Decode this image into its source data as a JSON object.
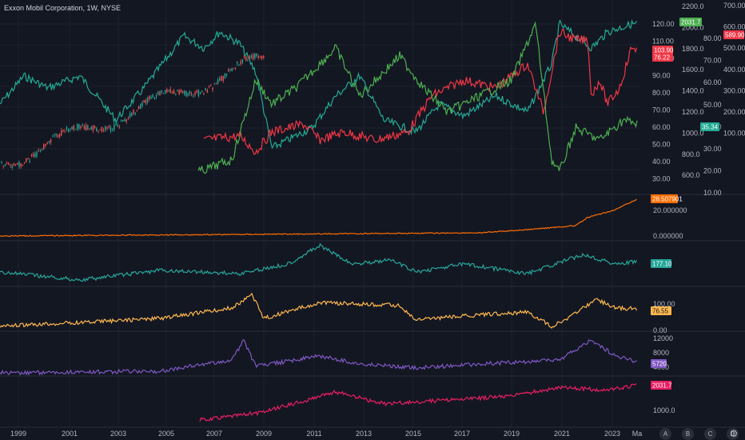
{
  "header": {
    "title": "Exxon Mobil Corporation, 1W, NYSE"
  },
  "colors": {
    "background": "#131722",
    "grid": "#1e222d",
    "separator": "#2a2e39",
    "bull": "#26a69a",
    "bear": "#ef5350",
    "teal_line": "#22ab94",
    "red_line": "#f23645",
    "green_line": "#4caf50",
    "orange": "#ff6d00",
    "yellow": "#ffb74d",
    "purple": "#7e57c2",
    "magenta": "#e91e63",
    "teal2": "#26a69a"
  },
  "main_pane": {
    "axis_a": [
      "120.00",
      "110.00",
      "100.00",
      "90.00",
      "80.00",
      "70.00",
      "60.00",
      "50.00",
      "40.00",
      "30.00"
    ],
    "axis_b": [
      "2200.0",
      "2000.0",
      "1800.0",
      "1600.0",
      "1400.0",
      "1200.0",
      "1000.0",
      "800.0",
      "600.0"
    ],
    "axis_c": [
      "80.00",
      "70.00",
      "60.00",
      "50.00",
      "40.00",
      "30.00",
      "20.00",
      "10.00"
    ],
    "axis_d": [
      "700.00",
      "600.00",
      "500.00",
      "400.00",
      "300.00",
      "200.00",
      "100.00"
    ],
    "tags": {
      "green": "2031.7",
      "red": "589.90",
      "price_red_top": "103.90",
      "price_red_bottom": "76.22",
      "teal": "35.34"
    }
  },
  "pane_orange": {
    "axis": [
      "20.000000",
      "0.000000"
    ],
    "tag": "28.507901"
  },
  "pane_teal": {
    "tag": "177.10"
  },
  "pane_yellow": {
    "axis": [
      "100.00",
      "0.00"
    ],
    "tag": "76.55"
  },
  "pane_purple": {
    "axis": [
      "12000",
      "8000",
      "4000"
    ],
    "tag": "5720"
  },
  "pane_magenta": {
    "axis": [
      "1000.0"
    ],
    "tag": "2031.7"
  },
  "time_axis": [
    "1999",
    "2001",
    "2003",
    "2005",
    "2007",
    "2009",
    "2011",
    "2013",
    "2015",
    "2017",
    "2019",
    "2021",
    "2023",
    "Ma"
  ],
  "scale_buttons": [
    "A",
    "B",
    "C",
    "D"
  ]
}
